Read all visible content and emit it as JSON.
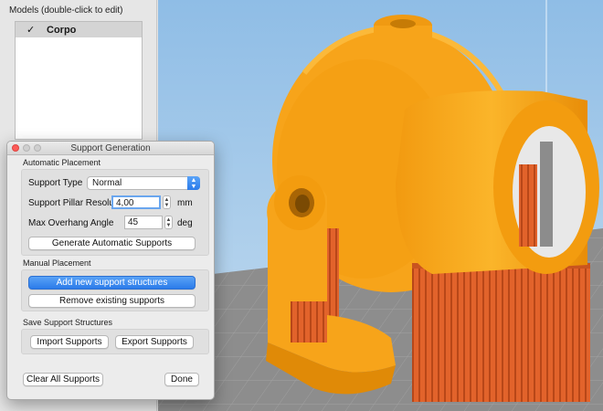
{
  "models_panel": {
    "title": "Models (double-click to edit)",
    "items": [
      {
        "checked": true,
        "check_glyph": "✓",
        "name": "Corpo"
      }
    ]
  },
  "dialog": {
    "title": "Support Generation",
    "automatic": {
      "section_label": "Automatic Placement",
      "support_type_label": "Support Type",
      "support_type_value": "Normal",
      "pillar_resolution_label": "Support Pillar Resolution",
      "pillar_resolution_value": "4,00",
      "pillar_resolution_unit": "mm",
      "overhang_label": "Max Overhang Angle",
      "overhang_value": "45",
      "overhang_unit": "deg",
      "generate_button": "Generate Automatic Supports"
    },
    "manual": {
      "section_label": "Manual Placement",
      "add_button": "Add new support structures",
      "remove_button": "Remove existing supports"
    },
    "save": {
      "section_label": "Save Support Structures",
      "import_button": "Import Supports",
      "export_button": "Export Supports"
    },
    "footer": {
      "clear_button": "Clear All Supports",
      "done_button": "Done"
    }
  },
  "colors": {
    "model_orange": "#f7a41a",
    "support_red": "#e2632b",
    "floor_gray": "#8d8d8d",
    "sky_blue": "#a9cdeb",
    "accent_blue": "#2b7bea"
  }
}
